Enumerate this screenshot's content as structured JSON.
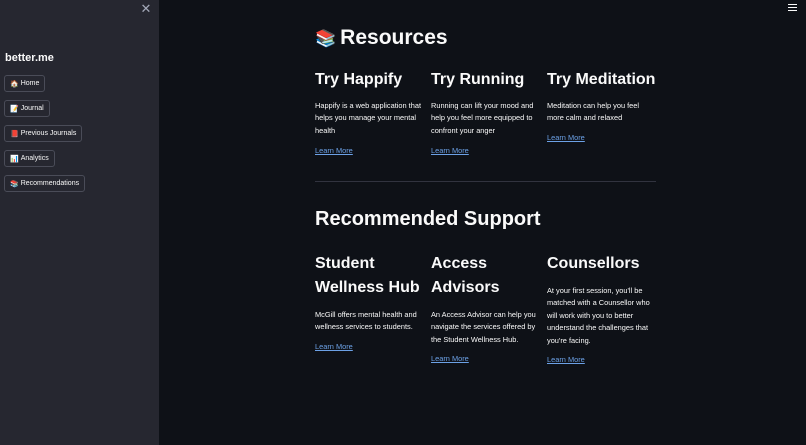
{
  "sidebar": {
    "close_glyph": "✕",
    "brand": "better.me",
    "items": [
      {
        "icon": "🏠",
        "label": "Home"
      },
      {
        "icon": "📝",
        "label": "Journal"
      },
      {
        "icon": "📕",
        "label": "Previous Journals"
      },
      {
        "icon": "📊",
        "label": "Analytics"
      },
      {
        "icon": "📚",
        "label": "Recommendations"
      }
    ]
  },
  "main": {
    "title_icon": "📚",
    "title": "Resources",
    "resources": [
      {
        "title": "Try Happify",
        "description": "Happify is a web application that helps you manage your mental health",
        "link": "Learn More"
      },
      {
        "title": "Try Running",
        "description": "Running can lift your mood and help you feel more equipped to confront your anger",
        "link": "Learn More"
      },
      {
        "title": "Try Meditation",
        "description": "Meditation can help you feel more calm and relaxed",
        "link": "Learn More"
      }
    ],
    "support_title": "Recommended Support",
    "support": [
      {
        "title": "Student Wellness Hub",
        "description": "McGill offers mental health and wellness services to students.",
        "link": "Learn More"
      },
      {
        "title": "Access Advisors",
        "description": "An Access Advisor can help you navigate the services offered by the Student Wellness Hub.",
        "link": "Learn More"
      },
      {
        "title": "Counsellors",
        "description": "At your first session, you'll be matched with a Counsellor who will work with you to better understand the challenges that you're facing.",
        "link": "Learn More"
      }
    ]
  },
  "colors": {
    "background": "#0e1117",
    "sidebar": "#262730",
    "link": "#6ca1e6",
    "text": "#fafafa"
  }
}
